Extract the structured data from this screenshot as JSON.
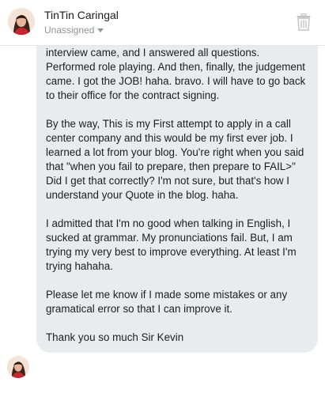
{
  "header": {
    "contact_name": "TinTin Caringal",
    "assignment": "Unassigned",
    "avatar_icon": "profile-photo",
    "trash_icon": "trash-icon"
  },
  "message": {
    "paragraphs": [
      "interview came, and I answered all questions. Performed role playing. And then, finally, the judgement came. I got the JOB! haha. bravo. I will have to go back to their office for the contract signing.",
      "By the way, This is my First attempt to apply in a call center company and this would be my first ever job. I learned a lot from your blog. You're right when you said that \"when you fail to prepare, then prepare to FAIL>\" Did I get that correctly? I'm not sure, but that's how I understand your Quote in the blog. haha.",
      "I admitted that I'm no good when talking  in English, I sucked at grammar. My pronunciations fail. But, I am trying my very best to improve everything. At least I'm trying hahaha.",
      "Please let me know if I made some mistakes or any gramatical error so that I can improve it.",
      "Thank you so much Sir Kevin"
    ]
  },
  "colors": {
    "bubble_bg": "#e9ebee",
    "text": "#1c1e21",
    "muted": "#8d949e",
    "divider": "#e4e6eb"
  }
}
